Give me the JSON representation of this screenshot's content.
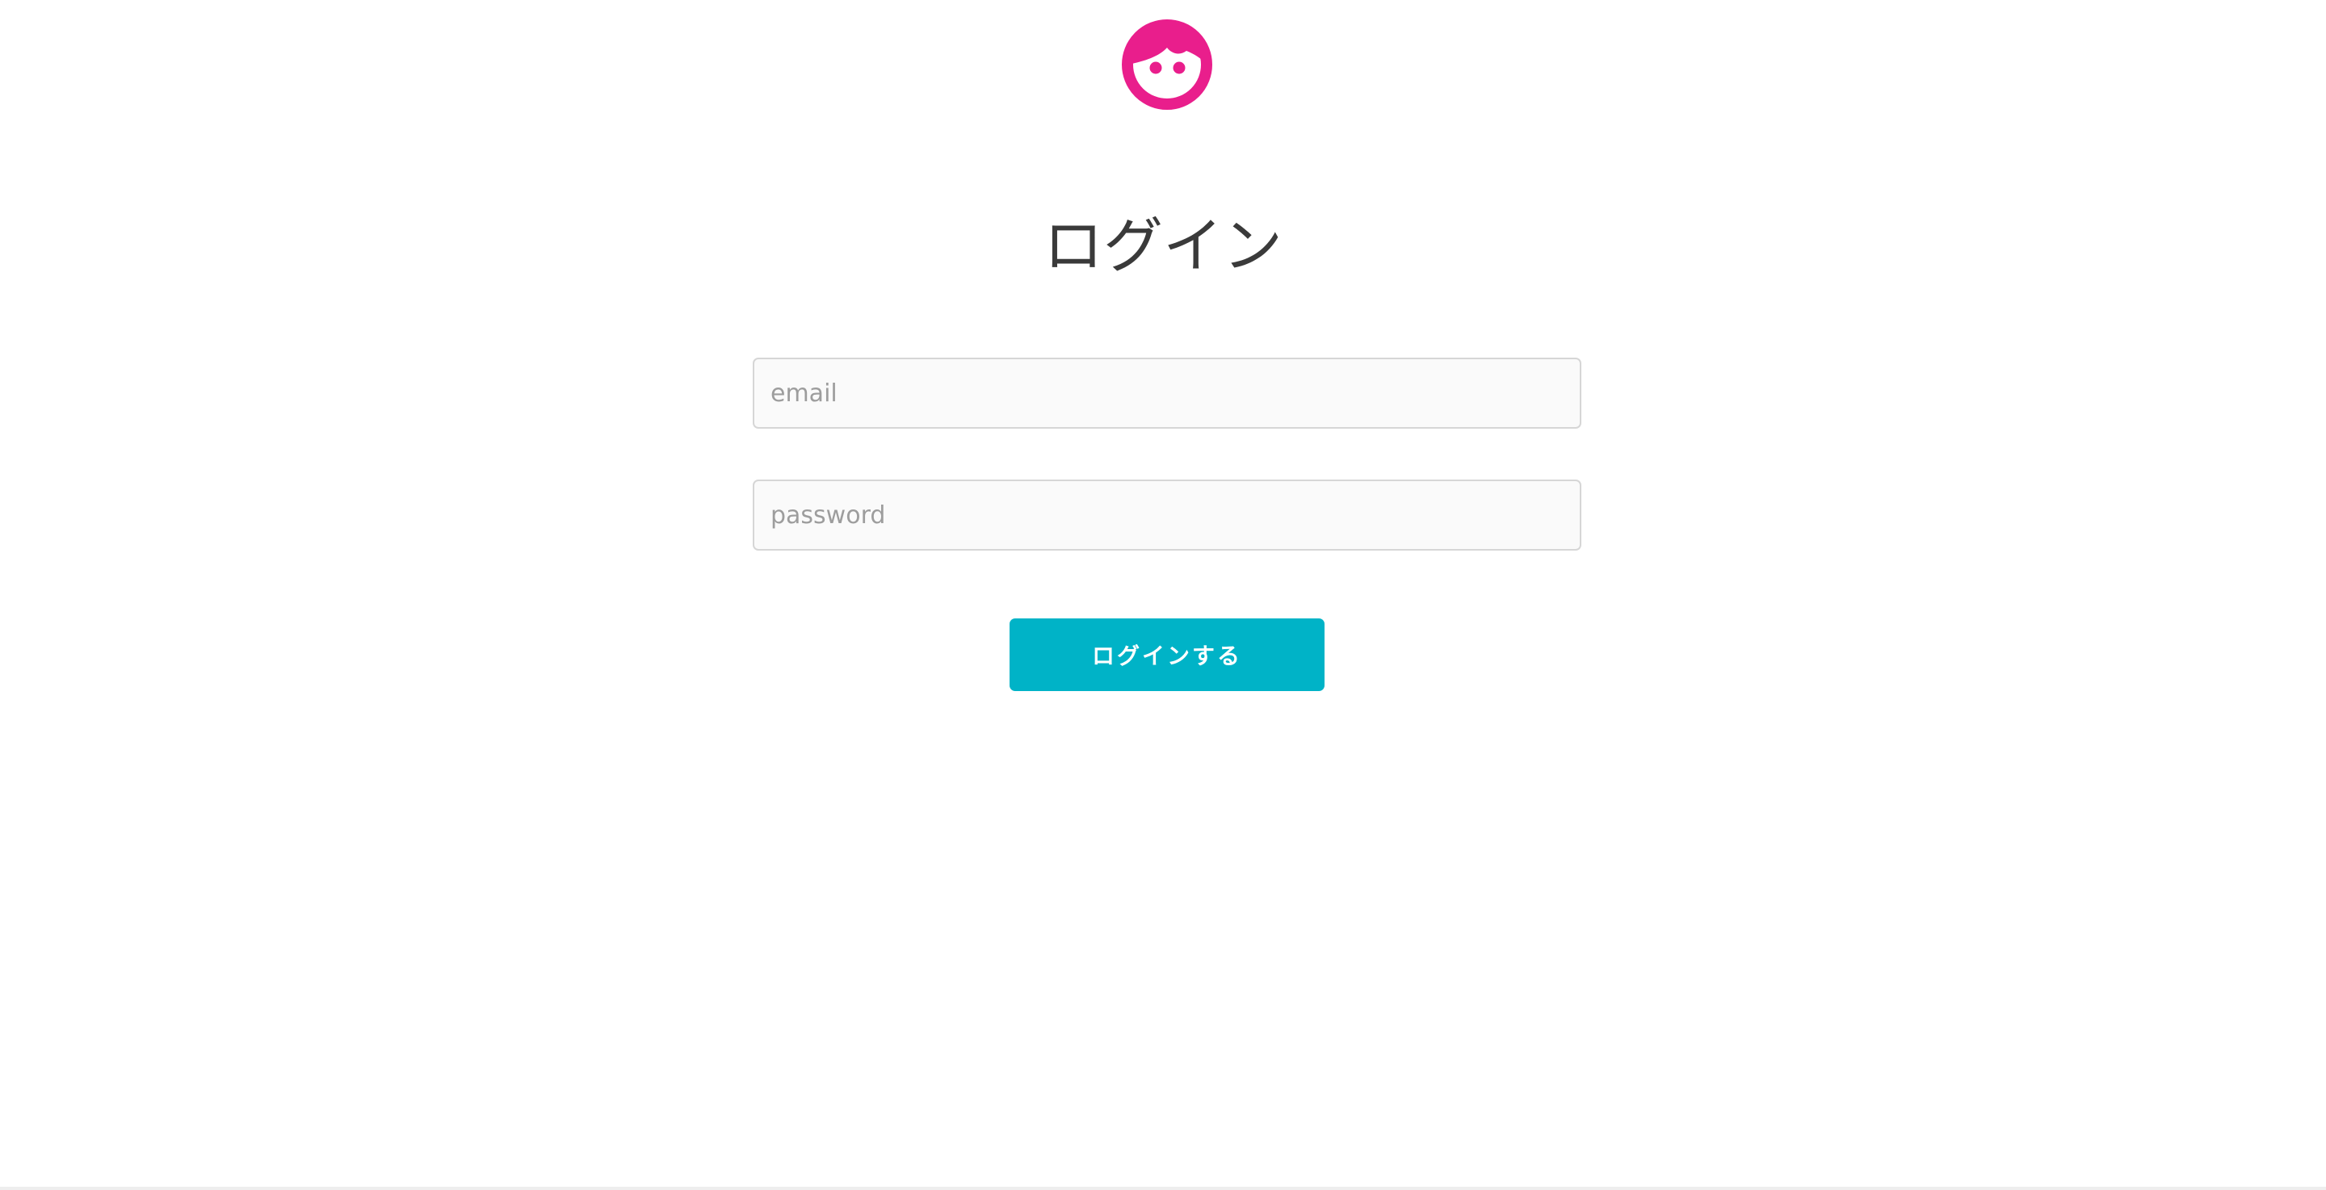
{
  "brand": {
    "logo_icon": "face-icon",
    "logo_color": "#e91e8c"
  },
  "login": {
    "title": "ログイン",
    "email_placeholder": "email",
    "password_placeholder": "password",
    "submit_label": "ログインする",
    "accent_color": "#00b3c7"
  }
}
